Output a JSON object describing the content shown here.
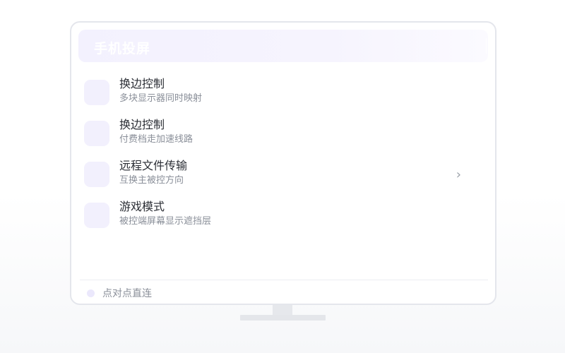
{
  "header": {
    "title": "手机投屏"
  },
  "items": [
    {
      "title": "换边控制",
      "subtitle": "多块显示器同时映射",
      "icon": "feature-icon",
      "has_chevron": false
    },
    {
      "title": "换边控制",
      "subtitle": "付费档走加速线路",
      "icon": "feature-icon",
      "has_chevron": false
    },
    {
      "title": "远程文件传输",
      "subtitle": "互换主被控方向",
      "icon": "feature-icon",
      "has_chevron": true
    },
    {
      "title": "游戏模式",
      "subtitle": "被控端屏幕显示遮挡层",
      "icon": "feature-icon",
      "has_chevron": false
    }
  ],
  "chevron": "›",
  "footer": {
    "label": "点对点直连",
    "dot_color": "#ebe8fc"
  },
  "colors": {
    "accent_light": "#f2f0fd",
    "text_primary": "#2a2d34",
    "text_secondary": "#8a8f99"
  }
}
